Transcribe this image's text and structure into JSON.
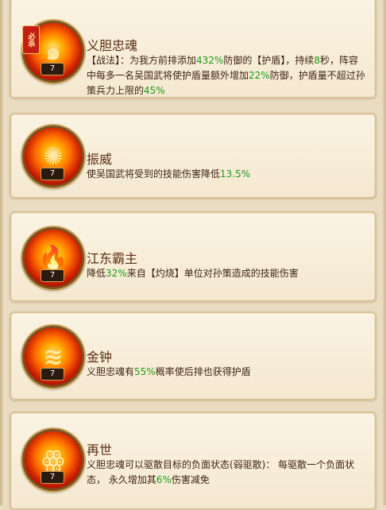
{
  "skills": [
    {
      "name": "义胆忠魂",
      "level": "7",
      "badge": "必杀",
      "icon": "flame-vortex-icon",
      "desc_parts": [
        {
          "t": "【战法】：为我方前排添加"
        },
        {
          "t": "432%",
          "g": true
        },
        {
          "t": "防御的【护盾】，持续"
        },
        {
          "t": "8",
          "g": true
        },
        {
          "t": "秒，阵容中每多一名吴国武将使护盾量额外增加"
        },
        {
          "t": "22%",
          "g": true
        },
        {
          "t": "防御，护盾量不超过孙策兵力上限的"
        },
        {
          "t": "45%",
          "g": true
        }
      ]
    },
    {
      "name": "振威",
      "level": "7",
      "icon": "flame-burst-icon",
      "desc_parts": [
        {
          "t": "使吴国武将受到的技能伤害降低"
        },
        {
          "t": "13.5%",
          "g": true
        }
      ]
    },
    {
      "name": "江东霸主",
      "level": "7",
      "icon": "fire-icon",
      "desc_parts": [
        {
          "t": "降低"
        },
        {
          "t": "32%",
          "g": true
        },
        {
          "t": "来自【灼烧】单位对孙策造成的技能伤害"
        }
      ]
    },
    {
      "name": "金钟",
      "level": "7",
      "icon": "flame-wave-icon",
      "desc_parts": [
        {
          "t": "义胆忠魂有"
        },
        {
          "t": "55%",
          "g": true
        },
        {
          "t": "概率使后排也获得护盾"
        }
      ]
    },
    {
      "name": "再世",
      "level": "7",
      "icon": "flame-figure-icon",
      "desc_parts": [
        {
          "t": "义胆忠魂可以驱散目标的负面状态(弱驱散)： 每驱散一个负面状态， 永久增加其"
        },
        {
          "t": "6%",
          "g": true
        },
        {
          "t": "伤害减免"
        }
      ]
    }
  ]
}
